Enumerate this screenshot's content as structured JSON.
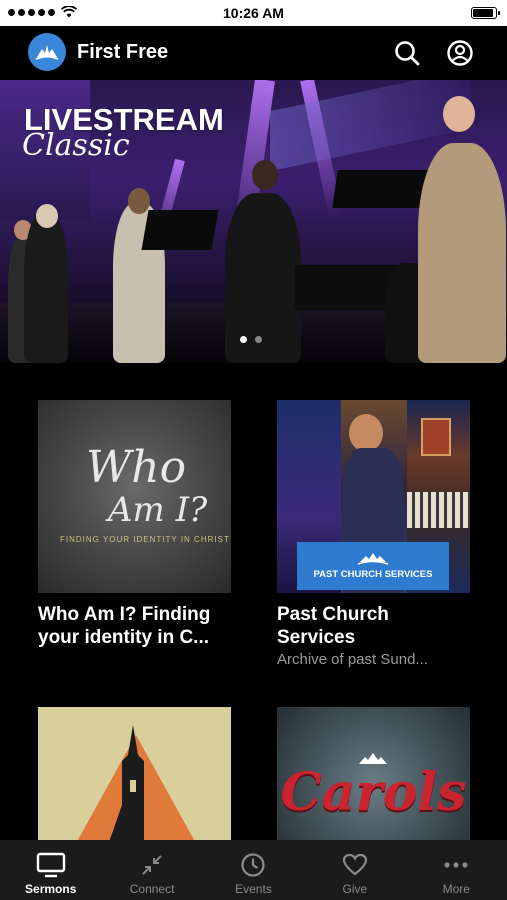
{
  "status_bar": {
    "time": "10:26 AM"
  },
  "header": {
    "title": "First Free",
    "icons": [
      "search-icon",
      "profile-icon"
    ]
  },
  "hero": {
    "title": "LIVESTREAM",
    "subtitle": "Classic",
    "pager": {
      "count": 2,
      "active_index": 0
    }
  },
  "cards": [
    {
      "title": "Who Am I? Finding your identity in C...",
      "subtitle": "",
      "art_text_1": "Who",
      "art_text_2": "Am I?",
      "art_caption": "FINDING YOUR IDENTITY IN CHRIST"
    },
    {
      "title": "Past Church Services",
      "subtitle": "Archive of past Sund...",
      "banner_text": "PAST CHURCH SERVICES"
    },
    {
      "title": "",
      "subtitle": ""
    },
    {
      "title": "",
      "subtitle": "",
      "art_text": "Carols"
    }
  ],
  "tabs": [
    {
      "label": "Sermons",
      "icon": "tv-icon",
      "active": true
    },
    {
      "label": "Connect",
      "icon": "connect-arrows-icon",
      "active": false
    },
    {
      "label": "Events",
      "icon": "clock-icon",
      "active": false
    },
    {
      "label": "Give",
      "icon": "heart-icon",
      "active": false
    },
    {
      "label": "More",
      "icon": "more-dots-icon",
      "active": false
    }
  ],
  "colors": {
    "accent": "#3a86d8",
    "background": "#000000",
    "tabbar": "#1b1b1b"
  }
}
